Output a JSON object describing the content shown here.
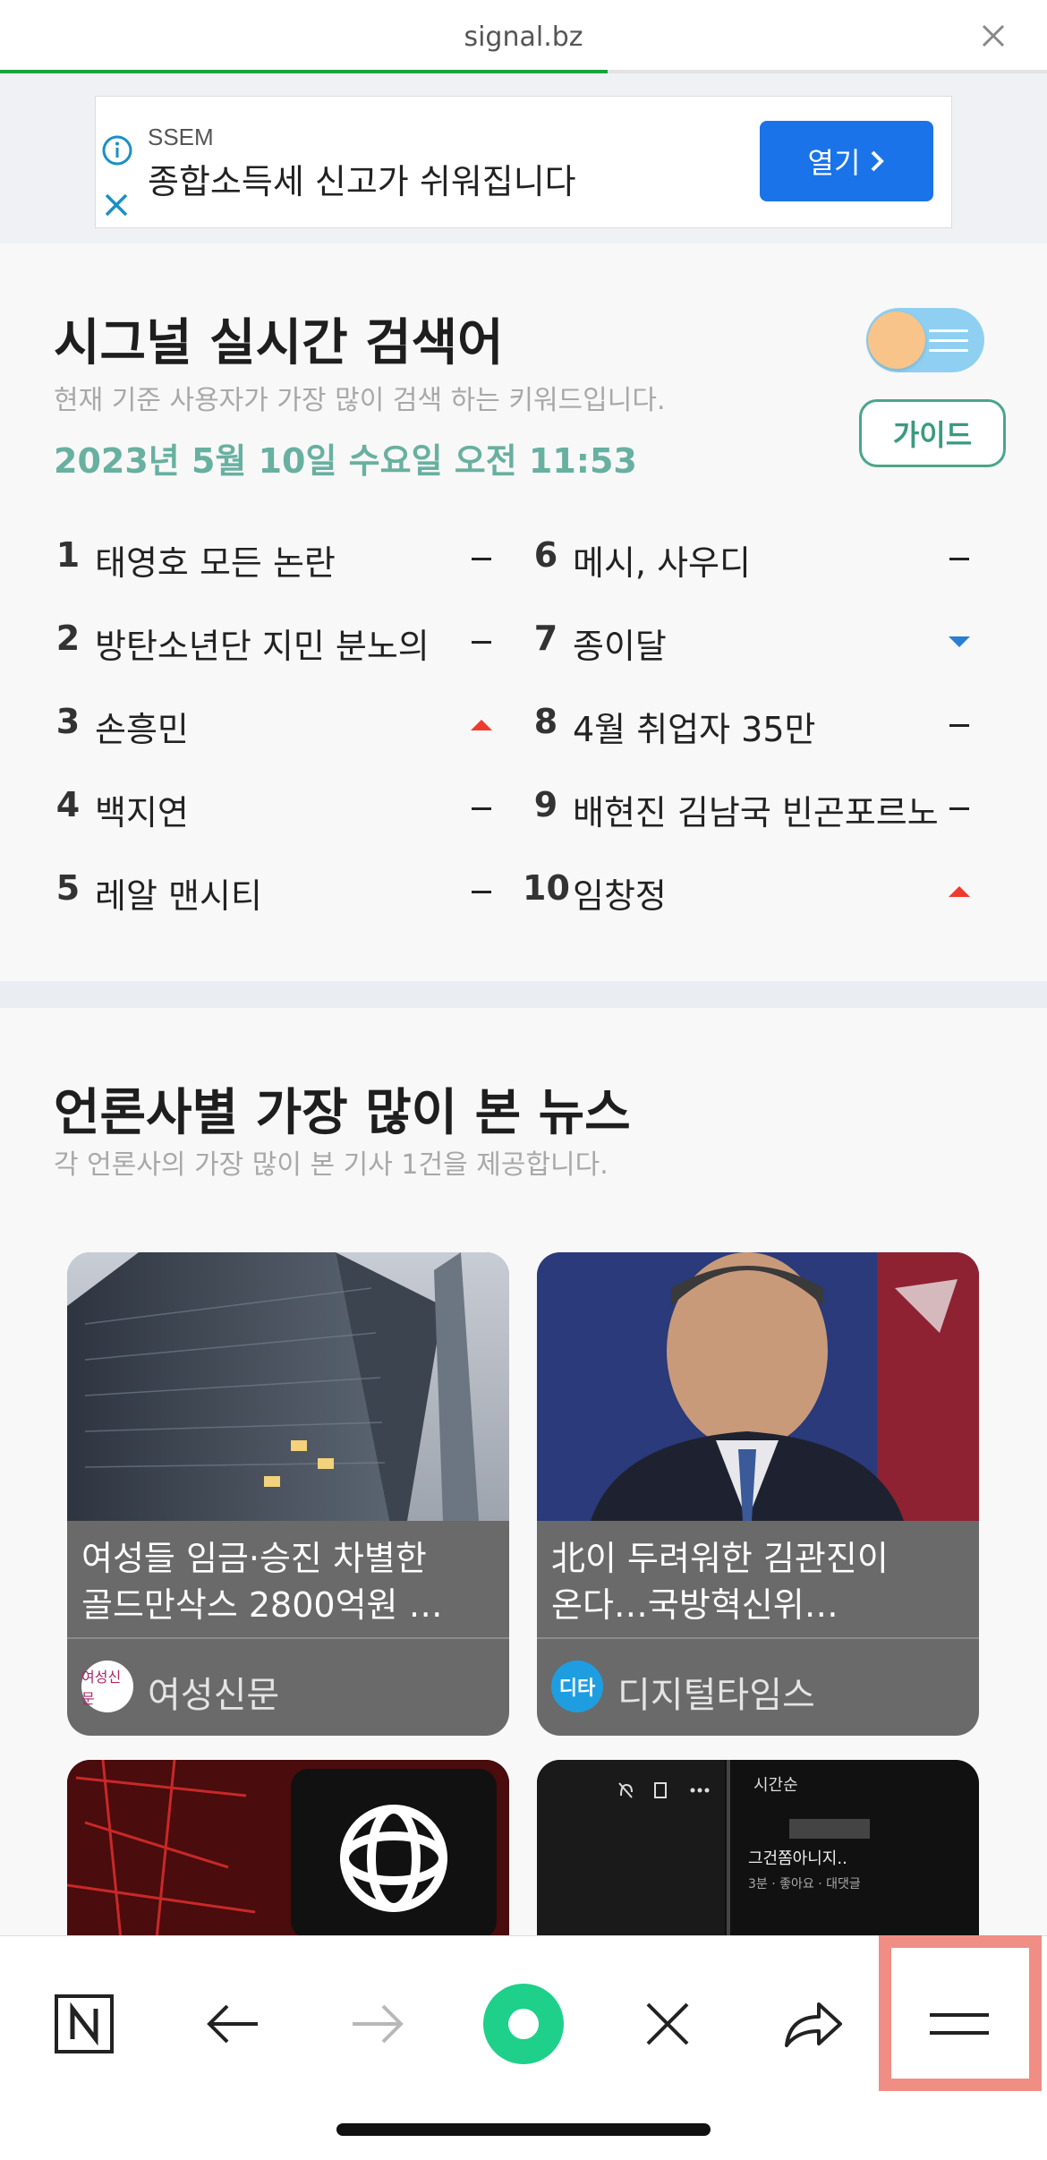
{
  "browser": {
    "url": "signal.bz",
    "progress_fraction": 0.58
  },
  "ad": {
    "brand": "SSEM",
    "headline": "종합소득세 신고가 쉬워집니다",
    "open_label": "열기",
    "accent": "#1a73e8"
  },
  "realtime": {
    "title": "시그널 실시간 검색어",
    "subtitle": "현재 기준 사용자가 가장 많이 검색 하는 키워드입니다.",
    "datetime": "2023년 5월 10일 수요일 오전 11:53",
    "guide_label": "가이드",
    "left": [
      {
        "rank": "1",
        "keyword": "태영호 모든 논란",
        "trend": "same"
      },
      {
        "rank": "2",
        "keyword": "방탄소년단 지민 분노의",
        "trend": "same"
      },
      {
        "rank": "3",
        "keyword": "손흥민",
        "trend": "up"
      },
      {
        "rank": "4",
        "keyword": "백지연",
        "trend": "same"
      },
      {
        "rank": "5",
        "keyword": "레알 맨시티",
        "trend": "same"
      }
    ],
    "right": [
      {
        "rank": "6",
        "keyword": "메시, 사우디",
        "trend": "same"
      },
      {
        "rank": "7",
        "keyword": "종이달",
        "trend": "down"
      },
      {
        "rank": "8",
        "keyword": "4월 취업자 35만",
        "trend": "same"
      },
      {
        "rank": "9",
        "keyword": "배현진 김남국 빈곤포르노",
        "trend": "same"
      },
      {
        "rank": "10",
        "keyword": "임창정",
        "trend": "up"
      }
    ],
    "colors": {
      "up": "#f03a2e",
      "down": "#2a7fd4",
      "same": "#222222"
    }
  },
  "news": {
    "title": "언론사별 가장 많이 본 뉴스",
    "subtitle": "각 언론사의 가장 많이 본 기사 1건을 제공합니다.",
    "cards": [
      {
        "headline_line1": "여성들 임금·승진 차별한",
        "headline_line2": "골드만삭스 2800억원 …",
        "source": "여성신문",
        "logo_text": "여성신문"
      },
      {
        "headline_line1": "北이 두려워한 김관진이",
        "headline_line2": "온다…국방혁신위…",
        "source": "디지털타임스",
        "logo_text": "디타"
      }
    ],
    "preview": {
      "sort_label": "시간순",
      "comment_text": "그건쫌아니지..",
      "comment_meta": "3분 · 좋아요 · 대댓글"
    }
  },
  "toolbar": {
    "items": [
      "n-logo-icon",
      "back-arrow-icon",
      "forward-arrow-icon",
      "home-circle-icon",
      "close-icon",
      "share-icon",
      "menu-icon"
    ]
  }
}
